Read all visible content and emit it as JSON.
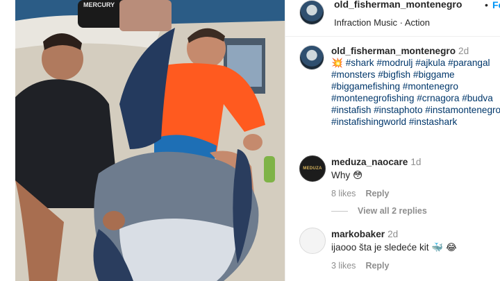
{
  "post": {
    "username": "old_fisherman_montenegro",
    "separator": "•",
    "follow_label": "Follow",
    "audio_label": "Infraction Music · Action"
  },
  "caption": {
    "username": "old_fisherman_montenegro",
    "time": "2d",
    "emoji": "💥",
    "hashtags": [
      "#shark",
      "#modrulj",
      "#ajkula",
      "#parangal",
      "#monsters",
      "#bigfish",
      "#biggame",
      "#biggamefishing",
      "#montenegro",
      "#montenegrofishing",
      "#crnagora",
      "#budva",
      "#instafish",
      "#instaphoto",
      "#instamontenegro",
      "#instafishingworld",
      "#instashark"
    ]
  },
  "comments": [
    {
      "username": "meduza_naocare",
      "time": "1d",
      "text": "Why 😳",
      "avatar_text": "MEDUZA",
      "likes": "8 likes",
      "reply_label": "Reply",
      "view_replies": "View all 2 replies"
    },
    {
      "username": "markobaker",
      "time": "2d",
      "text": "ijaooo šta je sledeće kit 🐳 😂",
      "likes": "3 likes",
      "reply_label": "Reply"
    }
  ],
  "media": {
    "outboard_brand": "MERCURY"
  },
  "colors": {
    "link_blue": "#0095f6",
    "hashtag": "#00376b",
    "meta_gray": "#8e8e8e"
  }
}
